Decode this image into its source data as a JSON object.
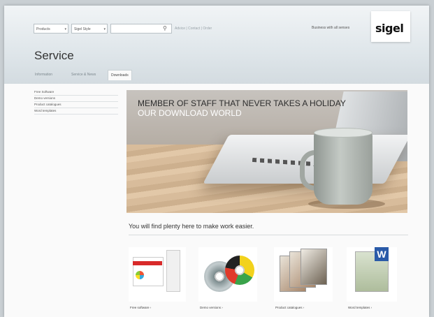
{
  "header": {
    "product_select": "Products",
    "brand_select": "Sigel Style",
    "search_placeholder": "",
    "quick_links": "Advice | Contact | Order",
    "slogan": "Business with all senses",
    "logo": "sigel"
  },
  "page_title": "Service",
  "tabs": [
    {
      "label": "Information"
    },
    {
      "label": "Service & News"
    },
    {
      "label": "Downloads",
      "active": true
    }
  ],
  "sidebar": {
    "items": [
      {
        "label": "Free Software"
      },
      {
        "label": "Demo versions"
      },
      {
        "label": "Product catalogues"
      },
      {
        "label": "Word templates"
      }
    ]
  },
  "hero": {
    "headline": "MEMBER OF STAFF THAT NEVER TAKES A HOLIDAY",
    "subheadline": "OUR DOWNLOAD WORLD"
  },
  "tagline": "You will find plenty here to make work easier.",
  "cards": [
    {
      "label": "Free software ›"
    },
    {
      "label": "Demo versions ›"
    },
    {
      "label": "Product catalogues ›"
    },
    {
      "label": "Word templates ›"
    }
  ],
  "colors": {
    "accent": "#d82a2a",
    "word_blue": "#2a5aa8"
  }
}
